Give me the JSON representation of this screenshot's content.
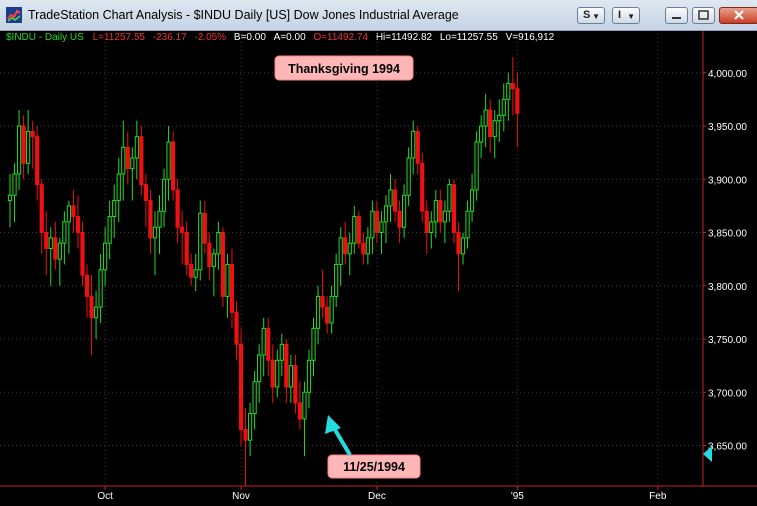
{
  "window": {
    "title": "TradeStation Chart Analysis - $INDU Daily [US] Dow Jones Industrial Average",
    "button_s": "S",
    "button_i": "I",
    "icons": [
      "chart-app-icon",
      "minimize-icon",
      "restore-icon",
      "close-icon"
    ]
  },
  "symbol_header": {
    "symbol": "$INDU - Daily  US",
    "last": "L=11257.55",
    "change": "-236.17",
    "change_pct": "-2.05%",
    "bid": "B=0.00",
    "ask": "A=0.00",
    "open": "O=11492.74",
    "high": "Hi=11492.82",
    "low": "Lo=11257.55",
    "volume": "V=916,912"
  },
  "annotations": {
    "title_box": "Thanksgiving 1994",
    "date_box": "11/25/1994"
  },
  "colors": {
    "background": "#000000",
    "up": "#22dd22",
    "down": "#ee1111",
    "axis": "#cc2222",
    "arrow": "#22dddd",
    "label_box": "#ffb6b6"
  },
  "chart_data": {
    "type": "candlestick",
    "title": "",
    "y_axis": {
      "ticks": [
        3650,
        3700,
        3750,
        3800,
        3850,
        3900,
        3950,
        4000
      ],
      "tick_labels": [
        "3,650.00",
        "3,700.00",
        "3,750.00",
        "3,800.00",
        "3,850.00",
        "3,900.00",
        "3,950.00",
        "4,000.00"
      ],
      "range": [
        3612,
        4027
      ]
    },
    "x_axis": {
      "labels": [
        {
          "label": "Oct",
          "bar": 21
        },
        {
          "label": "Nov",
          "bar": 51
        },
        {
          "label": "Dec",
          "bar": 81
        },
        {
          "label": "'95",
          "bar": 112
        },
        {
          "label": "Feb",
          "bar": 143
        }
      ]
    },
    "last_value_marker": 3642,
    "series": [
      {
        "values": [
          [
            3880,
            3905,
            3855,
            3885
          ],
          [
            3885,
            3915,
            3860,
            3905
          ],
          [
            3905,
            3965,
            3890,
            3950
          ],
          [
            3950,
            3960,
            3900,
            3915
          ],
          [
            3915,
            3965,
            3905,
            3945
          ],
          [
            3945,
            3955,
            3910,
            3940
          ],
          [
            3940,
            3950,
            3880,
            3895
          ],
          [
            3895,
            3900,
            3830,
            3850
          ],
          [
            3850,
            3870,
            3810,
            3835
          ],
          [
            3835,
            3855,
            3800,
            3845
          ],
          [
            3845,
            3860,
            3815,
            3825
          ],
          [
            3825,
            3845,
            3800,
            3840
          ],
          [
            3840,
            3870,
            3820,
            3860
          ],
          [
            3860,
            3880,
            3830,
            3875
          ],
          [
            3875,
            3890,
            3850,
            3865
          ],
          [
            3865,
            3885,
            3835,
            3850
          ],
          [
            3850,
            3860,
            3800,
            3810
          ],
          [
            3810,
            3820,
            3770,
            3790
          ],
          [
            3790,
            3810,
            3735,
            3770
          ],
          [
            3770,
            3795,
            3750,
            3780
          ],
          [
            3780,
            3830,
            3765,
            3815
          ],
          [
            3815,
            3855,
            3800,
            3840
          ],
          [
            3840,
            3880,
            3825,
            3865
          ],
          [
            3865,
            3895,
            3845,
            3880
          ],
          [
            3880,
            3920,
            3860,
            3905
          ],
          [
            3905,
            3955,
            3880,
            3930
          ],
          [
            3930,
            3945,
            3895,
            3910
          ],
          [
            3910,
            3930,
            3880,
            3920
          ],
          [
            3920,
            3955,
            3900,
            3940
          ],
          [
            3940,
            3950,
            3885,
            3895
          ],
          [
            3895,
            3905,
            3855,
            3880
          ],
          [
            3880,
            3890,
            3830,
            3845
          ],
          [
            3845,
            3870,
            3810,
            3855
          ],
          [
            3855,
            3885,
            3830,
            3870
          ],
          [
            3870,
            3910,
            3855,
            3900
          ],
          [
            3900,
            3950,
            3880,
            3935
          ],
          [
            3935,
            3945,
            3880,
            3890
          ],
          [
            3890,
            3900,
            3840,
            3855
          ],
          [
            3855,
            3870,
            3820,
            3850
          ],
          [
            3850,
            3860,
            3810,
            3820
          ],
          [
            3820,
            3830,
            3800,
            3808
          ],
          [
            3808,
            3830,
            3795,
            3815
          ],
          [
            3815,
            3880,
            3805,
            3868
          ],
          [
            3868,
            3880,
            3830,
            3840
          ],
          [
            3840,
            3850,
            3805,
            3818
          ],
          [
            3818,
            3835,
            3790,
            3830
          ],
          [
            3830,
            3860,
            3815,
            3850
          ],
          [
            3850,
            3855,
            3780,
            3790
          ],
          [
            3790,
            3830,
            3770,
            3820
          ],
          [
            3820,
            3835,
            3760,
            3775
          ],
          [
            3775,
            3785,
            3730,
            3745
          ],
          [
            3745,
            3760,
            3650,
            3665
          ],
          [
            3665,
            3685,
            3612,
            3655
          ],
          [
            3655,
            3690,
            3640,
            3680
          ],
          [
            3680,
            3720,
            3665,
            3710
          ],
          [
            3710,
            3745,
            3690,
            3735
          ],
          [
            3735,
            3770,
            3715,
            3760
          ],
          [
            3760,
            3770,
            3715,
            3730
          ],
          [
            3730,
            3745,
            3690,
            3705
          ],
          [
            3705,
            3740,
            3695,
            3730
          ],
          [
            3730,
            3755,
            3715,
            3745
          ],
          [
            3745,
            3750,
            3690,
            3705
          ],
          [
            3705,
            3735,
            3690,
            3725
          ],
          [
            3725,
            3735,
            3680,
            3690
          ],
          [
            3690,
            3710,
            3665,
            3675
          ],
          [
            3675,
            3710,
            3640,
            3700
          ],
          [
            3700,
            3740,
            3685,
            3730
          ],
          [
            3730,
            3770,
            3715,
            3760
          ],
          [
            3760,
            3800,
            3745,
            3790
          ],
          [
            3790,
            3815,
            3770,
            3780
          ],
          [
            3780,
            3790,
            3755,
            3765
          ],
          [
            3765,
            3800,
            3755,
            3790
          ],
          [
            3790,
            3830,
            3780,
            3820
          ],
          [
            3820,
            3855,
            3800,
            3845
          ],
          [
            3845,
            3860,
            3820,
            3830
          ],
          [
            3830,
            3850,
            3810,
            3840
          ],
          [
            3840,
            3875,
            3830,
            3865
          ],
          [
            3865,
            3870,
            3835,
            3840
          ],
          [
            3840,
            3850,
            3820,
            3830
          ],
          [
            3830,
            3855,
            3820,
            3845
          ],
          [
            3845,
            3880,
            3830,
            3870
          ],
          [
            3870,
            3880,
            3840,
            3850
          ],
          [
            3850,
            3870,
            3830,
            3860
          ],
          [
            3860,
            3885,
            3840,
            3875
          ],
          [
            3875,
            3905,
            3860,
            3890
          ],
          [
            3890,
            3900,
            3860,
            3870
          ],
          [
            3870,
            3880,
            3840,
            3855
          ],
          [
            3855,
            3895,
            3845,
            3885
          ],
          [
            3885,
            3930,
            3875,
            3920
          ],
          [
            3920,
            3955,
            3905,
            3945
          ],
          [
            3945,
            3950,
            3905,
            3915
          ],
          [
            3915,
            3925,
            3860,
            3870
          ],
          [
            3870,
            3880,
            3830,
            3850
          ],
          [
            3850,
            3870,
            3835,
            3860
          ],
          [
            3860,
            3890,
            3845,
            3880
          ],
          [
            3880,
            3890,
            3850,
            3860
          ],
          [
            3860,
            3880,
            3840,
            3870
          ],
          [
            3870,
            3900,
            3860,
            3895
          ],
          [
            3895,
            3900,
            3840,
            3850
          ],
          [
            3850,
            3860,
            3795,
            3830
          ],
          [
            3830,
            3850,
            3820,
            3845
          ],
          [
            3845,
            3880,
            3835,
            3870
          ],
          [
            3870,
            3905,
            3860,
            3890
          ],
          [
            3890,
            3945,
            3880,
            3935
          ],
          [
            3935,
            3960,
            3920,
            3950
          ],
          [
            3950,
            3980,
            3930,
            3965
          ],
          [
            3965,
            3975,
            3925,
            3940
          ],
          [
            3940,
            3965,
            3920,
            3955
          ],
          [
            3955,
            3975,
            3935,
            3960
          ],
          [
            3960,
            3990,
            3945,
            3975
          ],
          [
            3975,
            4000,
            3955,
            3990
          ],
          [
            3990,
            4015,
            3960,
            3985
          ],
          [
            3985,
            4000,
            3930,
            3962
          ]
        ]
      }
    ]
  }
}
